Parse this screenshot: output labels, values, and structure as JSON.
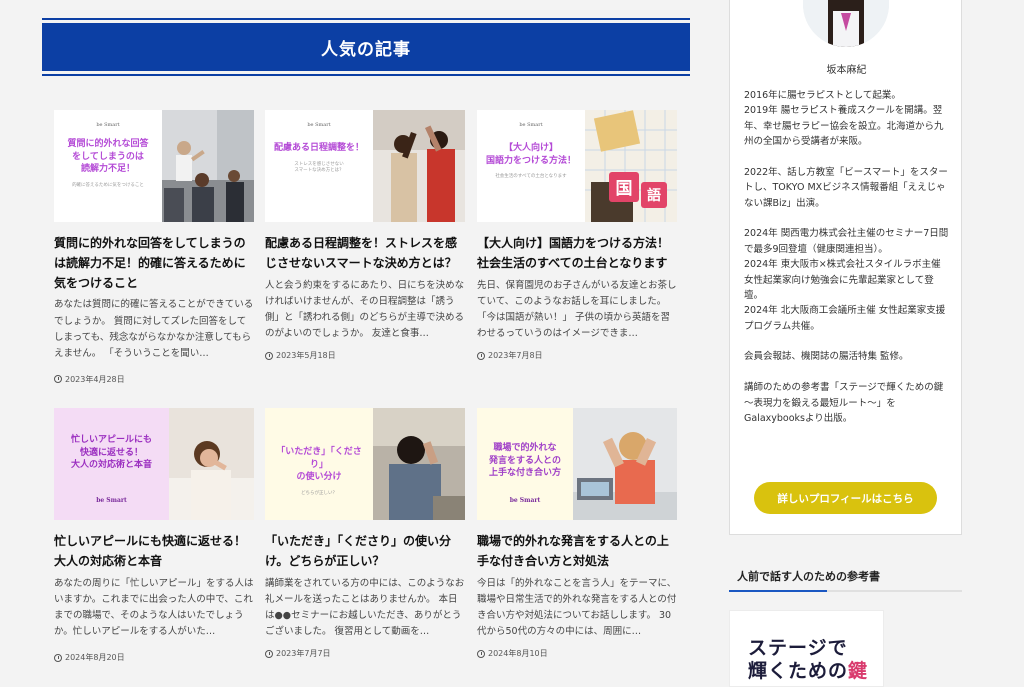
{
  "section": {
    "title": "人気の記事"
  },
  "articles": [
    {
      "thumb_brand": "be Smart",
      "thumb_title": "質問に的外れな回答\nをしてしまうのは\n読解力不足！",
      "thumb_sub": "的確に答えるために気をつけること",
      "title": "質問に的外れな回答をしてしまうのは読解力不足！的確に答えるために気をつけること",
      "excerpt": "あなたは質問に的確に答えることができているでしょうか。 質問に対してズレた回答をしてしまっても、残念ながらなかなか注意してもらえません。 「そういうことを聞い…",
      "date": "2023年4月28日"
    },
    {
      "thumb_brand": "be Smart",
      "thumb_title": "配慮ある日程調整を！",
      "thumb_sub": "ストレスを感じさせない\nスマートな決め方とは？",
      "title": "配慮ある日程調整を！ストレスを感じさせないスマートな決め方とは？",
      "excerpt": "人と会う約束をするにあたり、日にちを決めなければいけませんが、その日程調整は「誘う側」と「誘われる側」のどちらが主導で決めるのがよいのでしょうか。 友達と食事…",
      "date": "2023年5月18日"
    },
    {
      "thumb_brand": "be Smart",
      "thumb_title": "【大人向け】\n国語力をつける方法！",
      "thumb_sub": "社会生活のすべての土台となります",
      "title": "【大人向け】国語力をつける方法！社会生活のすべての土台となります",
      "excerpt": "先日、保育園児のお子さんがいる友達とお茶していて、このようなお話しを耳にしました。 「今は国語が熱い！」 子供の頃から英語を習わせるっていうのはイメージできま…",
      "date": "2023年7月8日",
      "thumb_photo_text": "国",
      "thumb_photo_text2": "語"
    },
    {
      "thumb_brand": "be Smart",
      "thumb_title": "忙しいアピールにも\n快適に返せる！\n大人の対応術と本音",
      "thumb_sub": "",
      "title": "忙しいアピールにも快適に返せる！大人の対応術と本音",
      "excerpt": "あなたの周りに「忙しいアピール」をする人はいますか。これまでに出会った人の中で、これまでの職場で、そのような人はいたでしょうか。忙しいアピールをする人がいた…",
      "date": "2024年8月20日"
    },
    {
      "thumb_brand": "",
      "thumb_title": "「いただき」「くださり」\nの使い分け",
      "thumb_sub": "どちらが正しい？",
      "title": "「いただき」「くださり」の使い分け。どちらが正しい？",
      "excerpt": "講師業をされている方の中には、このようなお礼メールを送ったことはありませんか。 本日は●●セミナーにお越しいただき、ありがとうございました。 復習用として動画を…",
      "date": "2023年7月7日"
    },
    {
      "thumb_brand": "",
      "thumb_title": "職場で的外れな\n発言をする人との\n上手な付き合い方",
      "thumb_sub": "",
      "title": "職場で的外れな発言をする人との上手な付き合い方と対処法",
      "excerpt": "今日は「的外れなことを言う人」をテーマに、職場や日常生活で的外れな発言をする人との付き合い方や対処法についてお話しします。 30代から50代の方々の中には、周囲に…",
      "date": "2024年8月10日"
    }
  ],
  "thumb_logo": "be Smart",
  "profile": {
    "name": "坂本麻紀",
    "bio": "2016年に腸セラピストとして起業。\n2019年 腸セラピスト養成スクールを開講。翌年、幸せ腸セラピー協会を設立。北海道から九州の全国から受講者が来阪。\n\n2022年、話し方教室「ビースマート」をスタートし、TOKYO MXビジネス情報番組「ええじゃない課Biz」出演。\n\n2024年 関西電力株式会社主催のセミナー7日間で最多9回登壇（健康関連担当）。\n2024年 東大阪市×株式会社スタイルラボ主催 女性起業家向け勉強会に先輩起業家として登壇。\n2024年 北大阪商工会議所主催 女性起業家支援プログラム共催。\n\n会員会報誌、機関誌の腸活特集 監修。\n\n講師のための参考書「ステージで輝くための鍵～表現力を鍛える最短ルート～」をGalaxybooksより出版。",
    "button_label": "詳しいプロフィールはこちら"
  },
  "books": {
    "heading": "人前で話す人のための参考書",
    "cover_line1": "ステージで",
    "cover_line2_a": "輝くための",
    "cover_line2_b": "鍵"
  },
  "colors": {
    "heading_bg": "#0c3fa4",
    "button_bg": "#d9c20e",
    "thumb_text": "#b44ad6"
  }
}
